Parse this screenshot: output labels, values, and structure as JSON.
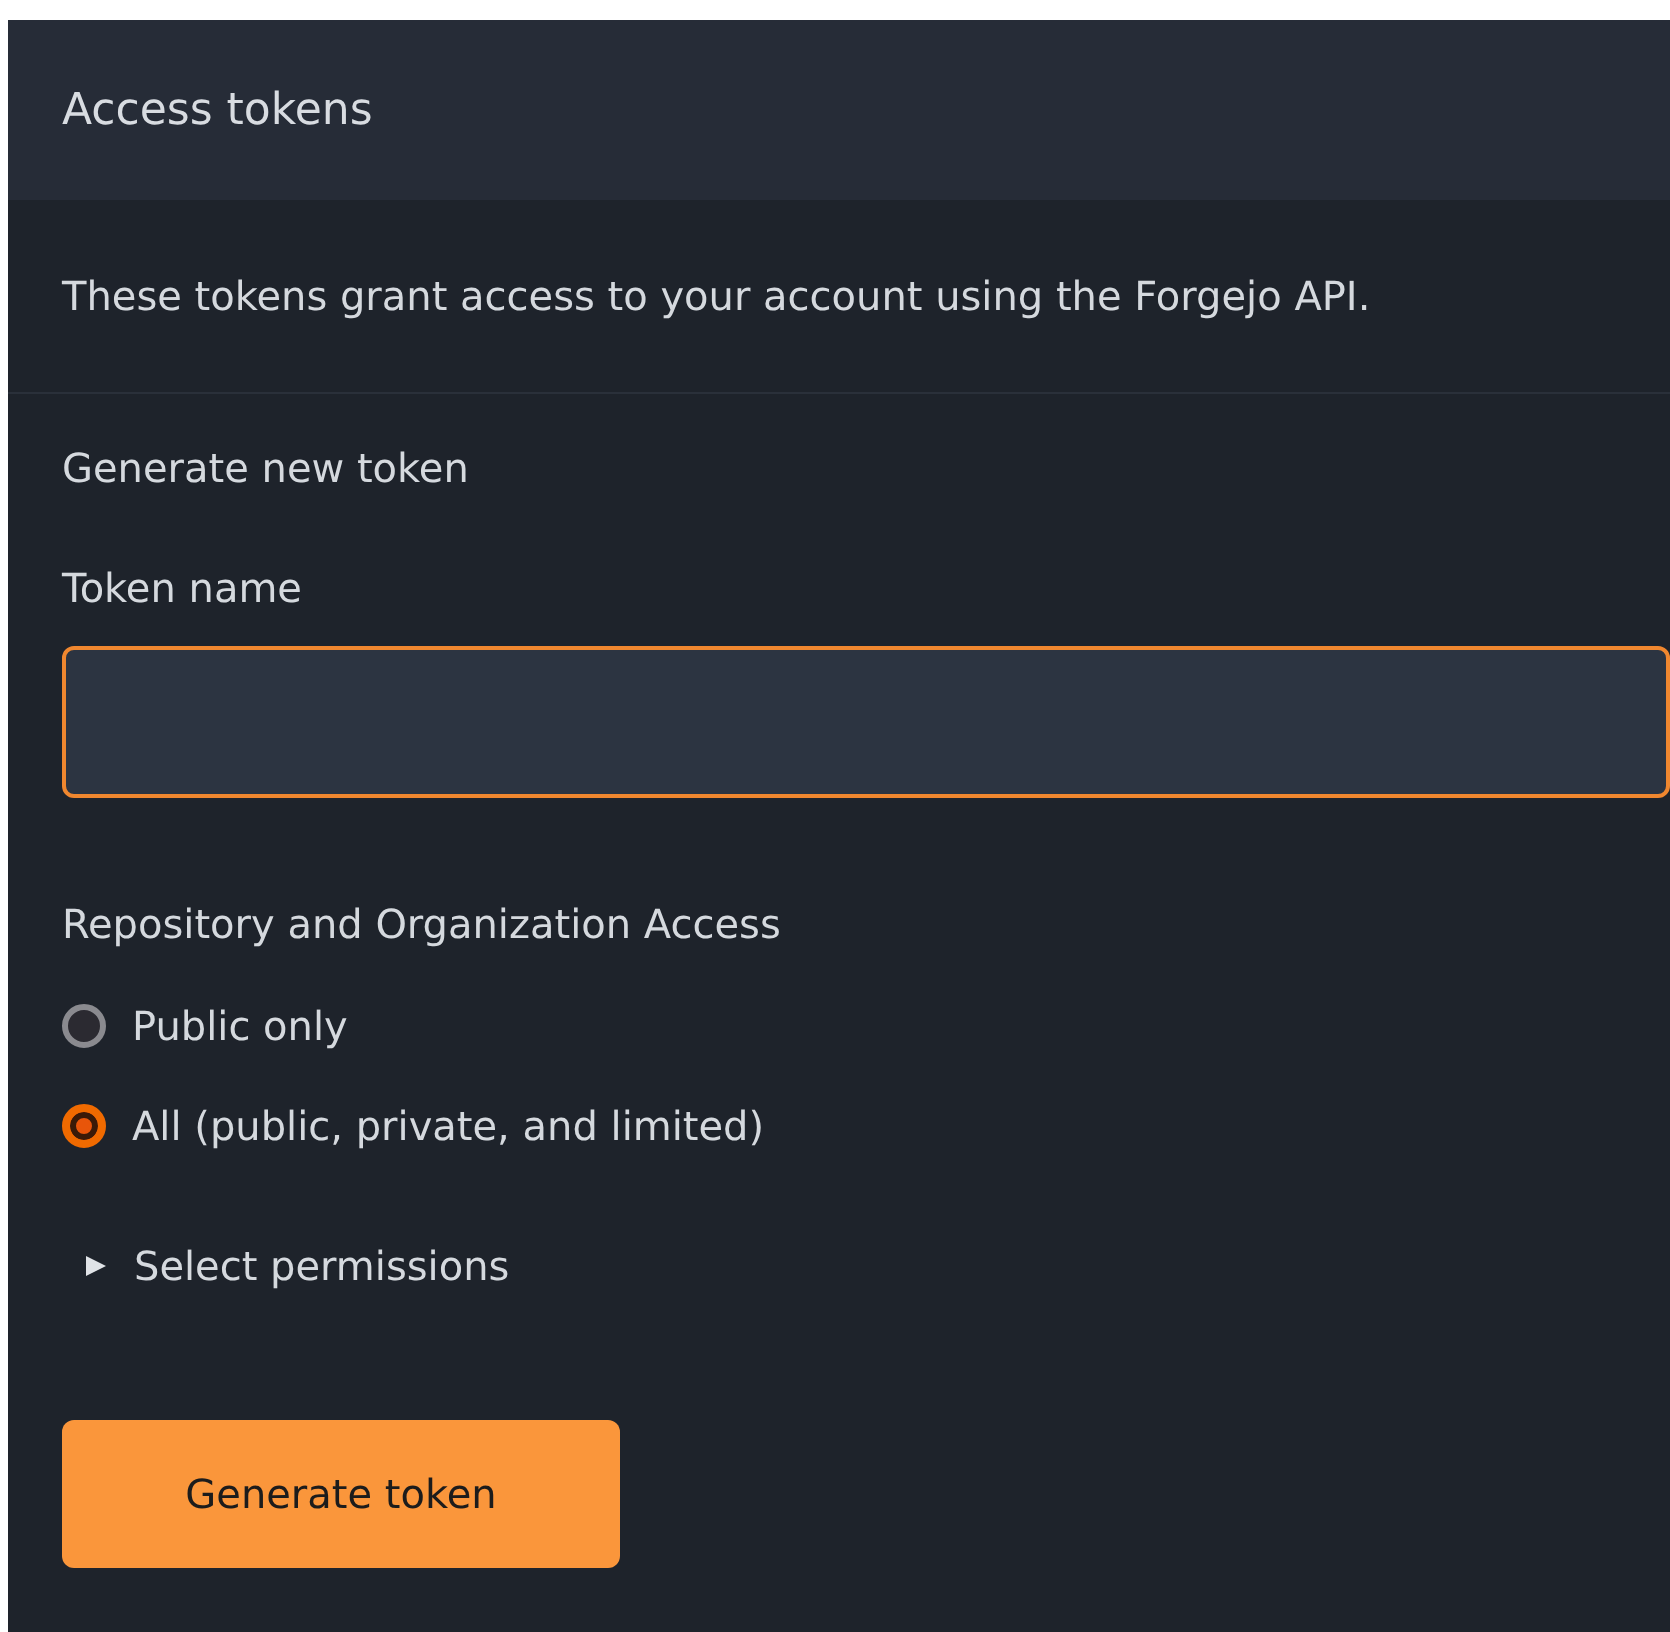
{
  "header": {
    "title": "Access tokens"
  },
  "description": "These tokens grant access to your account using the Forgejo API.",
  "form": {
    "heading": "Generate new token",
    "token_name": {
      "label": "Token name",
      "focused": true
    },
    "access": {
      "label": "Repository and Organization Access",
      "options": [
        {
          "label": "Public only",
          "selected": false
        },
        {
          "label": "All (public, private, and limited)",
          "selected": true
        }
      ]
    },
    "permissions": {
      "label": "Select permissions",
      "expanded": false
    },
    "submit": "Generate token"
  }
}
